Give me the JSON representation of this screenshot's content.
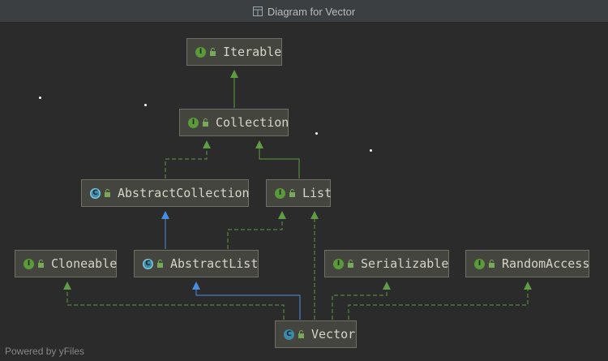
{
  "window": {
    "title": "Diagram for Vector",
    "icon": "class-diagram-icon"
  },
  "nodes": {
    "iterable": {
      "label": "Iterable",
      "kind": "interface",
      "badge": "I"
    },
    "collection": {
      "label": "Collection",
      "kind": "interface",
      "badge": "I"
    },
    "abstract_collection": {
      "label": "AbstractCollection",
      "kind": "abstract-class",
      "badge": "C"
    },
    "list": {
      "label": "List",
      "kind": "interface",
      "badge": "I"
    },
    "cloneable": {
      "label": "Cloneable",
      "kind": "interface",
      "badge": "I"
    },
    "abstract_list": {
      "label": "AbstractList",
      "kind": "abstract-class",
      "badge": "C"
    },
    "serializable": {
      "label": "Serializable",
      "kind": "interface",
      "badge": "I"
    },
    "random_access": {
      "label": "RandomAccess",
      "kind": "interface",
      "badge": "I"
    },
    "vector": {
      "label": "Vector",
      "kind": "class",
      "badge": "C"
    }
  },
  "relations": [
    {
      "from": "collection",
      "to": "iterable",
      "type": "extends-interface"
    },
    {
      "from": "abstract_collection",
      "to": "collection",
      "type": "implements"
    },
    {
      "from": "list",
      "to": "collection",
      "type": "extends-interface"
    },
    {
      "from": "abstract_list",
      "to": "abstract_collection",
      "type": "extends-class"
    },
    {
      "from": "abstract_list",
      "to": "list",
      "type": "implements"
    },
    {
      "from": "vector",
      "to": "abstract_list",
      "type": "extends-class"
    },
    {
      "from": "vector",
      "to": "list",
      "type": "implements"
    },
    {
      "from": "vector",
      "to": "cloneable",
      "type": "implements"
    },
    {
      "from": "vector",
      "to": "serializable",
      "type": "implements"
    },
    {
      "from": "vector",
      "to": "random_access",
      "type": "implements"
    }
  ],
  "colors": {
    "background": "#2b2b2b",
    "node_fill": "#45453f",
    "node_border": "#6f6f66",
    "interface_edge": "#5e9c45",
    "class_edge": "#4a8de0",
    "interface_badge": "#5a9a3a",
    "class_badge": "#3d8ba8"
  },
  "footer": {
    "text": "Powered by yFiles"
  }
}
